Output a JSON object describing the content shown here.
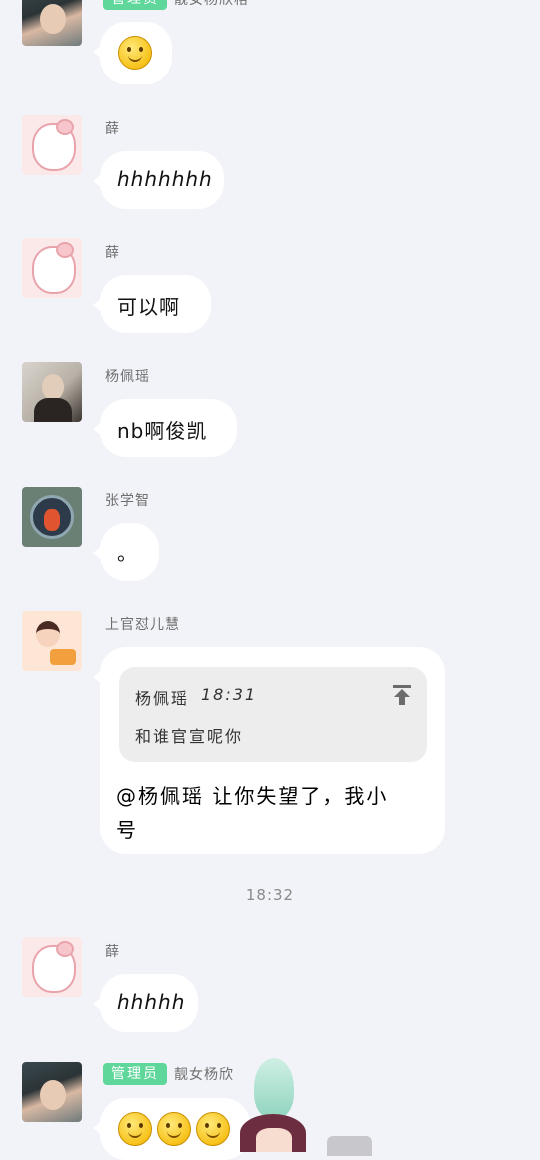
{
  "messages": [
    {
      "badge": "管理员",
      "name": "靓女杨欣格",
      "content": "",
      "content_emoji": [
        "smile"
      ]
    },
    {
      "name": "薛",
      "content": "hhhhhhh"
    },
    {
      "name": "薛",
      "content": "可以啊"
    },
    {
      "name": "杨佩瑶",
      "content": "nb啊俊凯"
    },
    {
      "name": "张学智",
      "content": "。"
    },
    {
      "name": "上官怼儿慧",
      "quote": {
        "author": "杨佩瑶",
        "time": "18:31",
        "text": "和谁官宣呢你"
      },
      "content_line1": "@杨佩瑶 让你失望了，我小",
      "content_line2": "号"
    },
    {
      "name": "薛",
      "content": "hhhhh"
    },
    {
      "badge": "管理员",
      "name": "靓女杨欣",
      "content_emoji": [
        "smile",
        "smile",
        "smile"
      ]
    }
  ],
  "timestamp": "18:32",
  "colors": {
    "background": "#f2f3f8",
    "badge": "#5fd79b",
    "bubble": "#ffffff",
    "quote_bg": "#ededed"
  },
  "icons": {
    "quote_jump": "arrow-up-to-top-icon",
    "emoji": "smile-emoji-icon"
  }
}
